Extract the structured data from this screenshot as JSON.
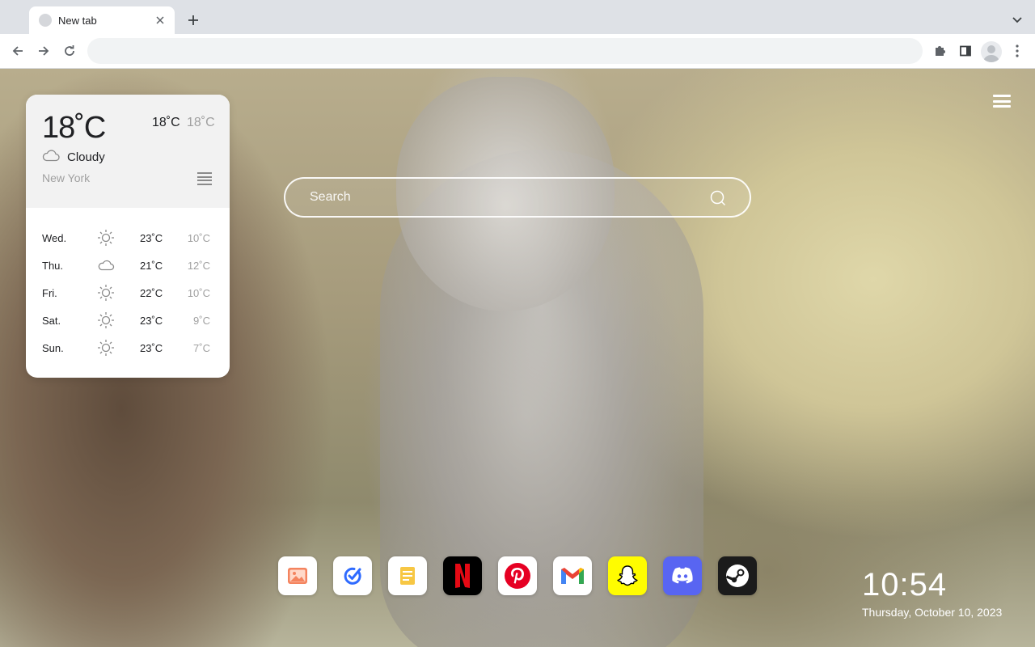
{
  "tab": {
    "title": "New tab"
  },
  "omnibox": {
    "value": ""
  },
  "weather": {
    "current_temp": "18˚C",
    "high": "18˚C",
    "low": "18˚C",
    "condition": "Cloudy",
    "condition_icon": "cloud-icon",
    "city": "New York",
    "forecast": [
      {
        "day": "Wed.",
        "icon": "sun-icon",
        "high": "23˚C",
        "low": "10˚C"
      },
      {
        "day": "Thu.",
        "icon": "cloud-icon",
        "high": "21˚C",
        "low": "12˚C"
      },
      {
        "day": "Fri.",
        "icon": "sun-icon",
        "high": "22˚C",
        "low": "10˚C"
      },
      {
        "day": "Sat.",
        "icon": "sun-icon",
        "high": "23˚C",
        "low": "9˚C"
      },
      {
        "day": "Sun.",
        "icon": "sun-icon",
        "high": "23˚C",
        "low": "7˚C"
      }
    ]
  },
  "search": {
    "placeholder": "Search"
  },
  "dock": [
    {
      "icon": "photos-icon",
      "color": "#ffffff"
    },
    {
      "icon": "tasks-icon",
      "color": "#ffffff"
    },
    {
      "icon": "notes-icon",
      "color": "#ffffff"
    },
    {
      "icon": "netflix-icon",
      "color": "#000000"
    },
    {
      "icon": "pinterest-icon",
      "color": "#ffffff"
    },
    {
      "icon": "gmail-icon",
      "color": "#ffffff"
    },
    {
      "icon": "snapchat-icon",
      "color": "#fffc00"
    },
    {
      "icon": "discord-icon",
      "color": "#5865f2"
    },
    {
      "icon": "steam-icon",
      "color": "#1b1b1b"
    }
  ],
  "clock": {
    "time": "10:54",
    "date": "Thursday, October 10, 2023"
  },
  "colors": {
    "netflix_red": "#e50914",
    "pinterest_red": "#e60023",
    "gmail_red": "#ea4335"
  }
}
